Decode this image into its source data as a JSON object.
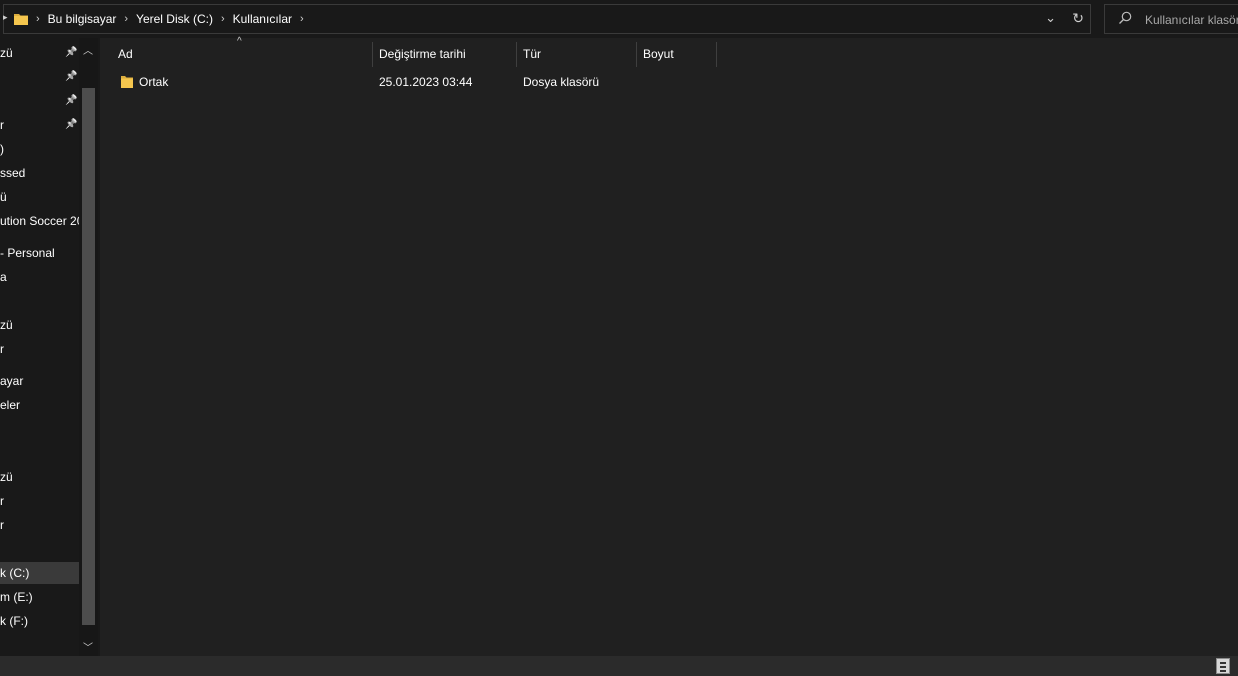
{
  "address_bar": {
    "breadcrumbs": [
      "Bu bilgisayar",
      "Yerel Disk (C:)",
      "Kullanıcılar"
    ],
    "icons": [
      "folder-icon",
      "chevron-right-icon",
      "chevron-down-icon",
      "refresh-icon"
    ]
  },
  "search": {
    "placeholder": "Kullanıcılar klasöründe ara",
    "icon": "search-icon"
  },
  "nav": {
    "items": [
      {
        "label": "zü",
        "pinned": true
      },
      {
        "label": "",
        "pinned": true
      },
      {
        "label": "",
        "pinned": true
      },
      {
        "label": "r",
        "pinned": true
      },
      {
        "label": ")",
        "pinned": false
      },
      {
        "label": "ssed",
        "pinned": false
      },
      {
        "label": "ü",
        "pinned": false
      },
      {
        "label": "ution Soccer 20",
        "pinned": false
      },
      {
        "label": "- Personal",
        "pinned": false
      },
      {
        "label": "a",
        "pinned": false
      },
      {
        "label": "",
        "pinned": false
      },
      {
        "label": "zü",
        "pinned": false
      },
      {
        "label": "r",
        "pinned": false
      },
      {
        "label": "ayar",
        "pinned": false
      },
      {
        "label": "eler",
        "pinned": false
      },
      {
        "label": "",
        "pinned": false
      },
      {
        "label": "zü",
        "pinned": false
      },
      {
        "label": "r",
        "pinned": false
      },
      {
        "label": "r",
        "pinned": false
      },
      {
        "label": "",
        "pinned": false
      },
      {
        "label": "k (C:)",
        "pinned": false,
        "selected": true
      },
      {
        "label": "m (E:)",
        "pinned": false
      },
      {
        "label": "k (F:)",
        "pinned": false
      }
    ]
  },
  "columns": {
    "name": "Ad",
    "modified": "Değiştirme tarihi",
    "type": "Tür",
    "size": "Boyut"
  },
  "files": [
    {
      "name": "Ortak",
      "modified": "25.01.2023 03:44",
      "type": "Dosya klasörü",
      "size": "",
      "icon": "folder-icon"
    }
  ],
  "colors": {
    "window_bg": "#191919",
    "content_bg": "#202020",
    "folder": "#f5c64e",
    "selected_nav": "#3a3a3a"
  }
}
